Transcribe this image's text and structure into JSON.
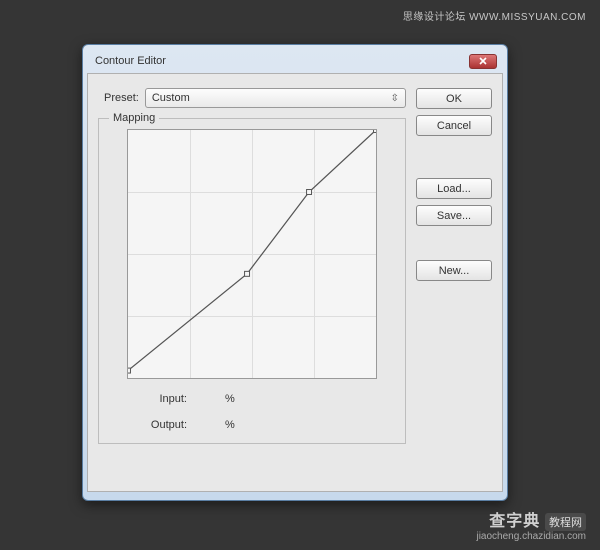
{
  "watermarks": {
    "top": "思缘设计论坛  WWW.MISSYUAN.COM",
    "bottom_brand": "查字典",
    "bottom_tag": "教程网",
    "bottom_url": "jiaocheng.chazidian.com"
  },
  "window": {
    "title": "Contour Editor"
  },
  "preset": {
    "label": "Preset:",
    "value": "Custom"
  },
  "mapping": {
    "label": "Mapping",
    "input_label": "Input:",
    "output_label": "Output:",
    "unit": "%"
  },
  "buttons": {
    "ok": "OK",
    "cancel": "Cancel",
    "load": "Load...",
    "save": "Save...",
    "new": "New..."
  },
  "chart_data": {
    "type": "line",
    "title": "",
    "xlabel": "Input",
    "ylabel": "Output",
    "xlim": [
      0,
      100
    ],
    "ylim": [
      0,
      100
    ],
    "x": [
      0,
      48,
      73,
      100
    ],
    "y": [
      3,
      42,
      75,
      100
    ]
  }
}
